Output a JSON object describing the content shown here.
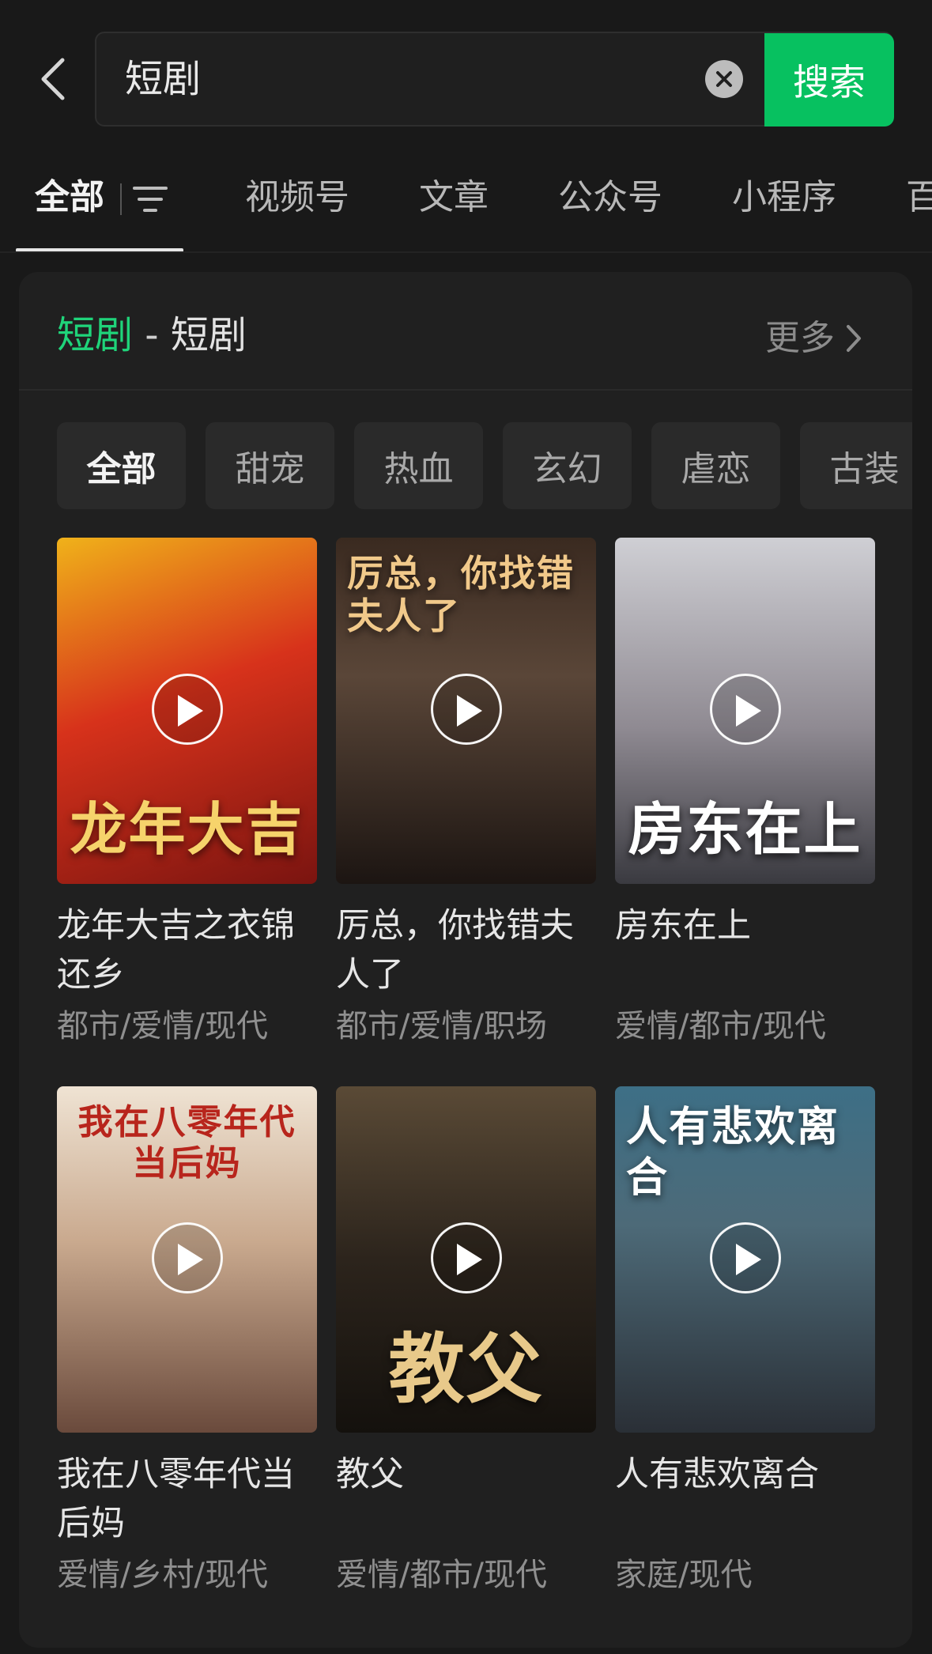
{
  "search": {
    "query": "短剧",
    "button_label": "搜索"
  },
  "tabs": [
    {
      "label": "全部"
    },
    {
      "label": "视频号"
    },
    {
      "label": "文章"
    },
    {
      "label": "公众号"
    },
    {
      "label": "小程序"
    },
    {
      "label": "百"
    }
  ],
  "card": {
    "title_accent": "短剧",
    "title_sep": " - ",
    "title_sub": "短剧",
    "more_label": "更多",
    "categories": [
      {
        "label": "全部"
      },
      {
        "label": "甜宠"
      },
      {
        "label": "热血"
      },
      {
        "label": "玄幻"
      },
      {
        "label": "虐恋"
      },
      {
        "label": "古装"
      }
    ],
    "items": [
      {
        "title": "龙年大吉之衣锦还乡",
        "tags": "都市/爱情/现代",
        "poster_text": "龙年大吉"
      },
      {
        "title": "厉总，你找错夫人了",
        "tags": "都市/爱情/职场",
        "poster_text": "厉总，你找错夫人了"
      },
      {
        "title": "房东在上",
        "tags": "爱情/都市/现代",
        "poster_text": "房东在上"
      },
      {
        "title": "我在八零年代当后妈",
        "tags": "爱情/乡村/现代",
        "poster_text": "我在八零年代当后妈"
      },
      {
        "title": "教父",
        "tags": "爱情/都市/现代",
        "poster_text": "教父"
      },
      {
        "title": "人有悲欢离合",
        "tags": "家庭/现代",
        "poster_text": "人有悲欢离合"
      }
    ]
  },
  "colors": {
    "background": "#191919",
    "accent": "#07c160"
  }
}
